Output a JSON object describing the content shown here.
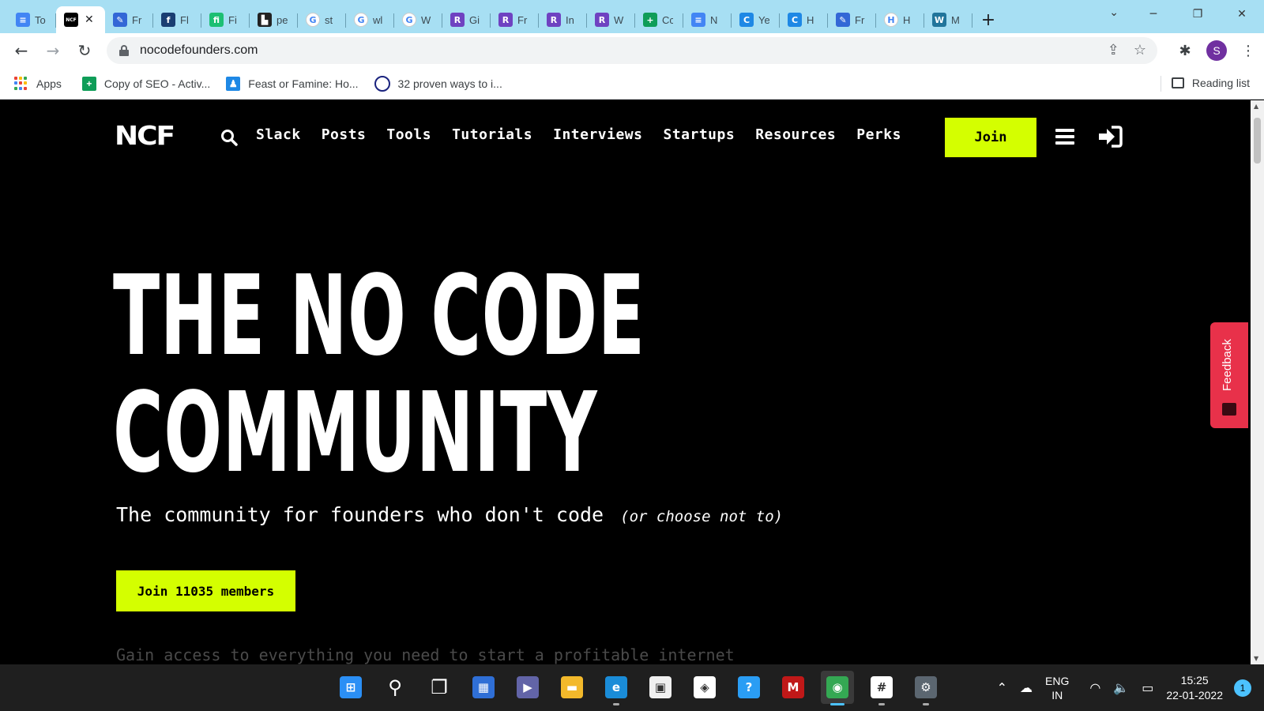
{
  "browser": {
    "tabs": [
      {
        "title": "To",
        "icon": "docs-icon",
        "color": "#4285f4",
        "glyph": "≡"
      },
      {
        "title": "",
        "icon": "ncf-icon",
        "color": "#000000",
        "glyph": "NCF",
        "active": true
      },
      {
        "title": "Fr",
        "icon": "doc-edit-icon",
        "color": "#3367d6",
        "glyph": "✎"
      },
      {
        "title": "Fl",
        "icon": "flip-icon",
        "color": "#1a3e72",
        "glyph": "f"
      },
      {
        "title": "Fi",
        "icon": "fiverr-icon",
        "color": "#1dbf73",
        "glyph": "fi"
      },
      {
        "title": "pe",
        "icon": "people-icon",
        "color": "#222222",
        "glyph": "▙"
      },
      {
        "title": "st",
        "icon": "google-icon",
        "color": "#ffffff",
        "glyph": "G"
      },
      {
        "title": "wl",
        "icon": "google-icon",
        "color": "#ffffff",
        "glyph": "G"
      },
      {
        "title": "W",
        "icon": "google-icon",
        "color": "#ffffff",
        "glyph": "G"
      },
      {
        "title": "Gi",
        "icon": "r-icon",
        "color": "#6f42c1",
        "glyph": "R"
      },
      {
        "title": "Fr",
        "icon": "r-icon",
        "color": "#6f42c1",
        "glyph": "R"
      },
      {
        "title": "In",
        "icon": "r-icon",
        "color": "#6f42c1",
        "glyph": "R"
      },
      {
        "title": "W",
        "icon": "r-icon",
        "color": "#6f42c1",
        "glyph": "R"
      },
      {
        "title": "Cc",
        "icon": "sheets-icon",
        "color": "#0f9d58",
        "glyph": "+"
      },
      {
        "title": "N",
        "icon": "docs-icon",
        "color": "#4285f4",
        "glyph": "≡"
      },
      {
        "title": "Ye",
        "icon": "c-icon",
        "color": "#1e88e5",
        "glyph": "C"
      },
      {
        "title": "H",
        "icon": "c-icon",
        "color": "#1e88e5",
        "glyph": "C"
      },
      {
        "title": "Fr",
        "icon": "doc-edit-icon",
        "color": "#3367d6",
        "glyph": "✎"
      },
      {
        "title": "H",
        "icon": "h-icon",
        "color": "#ffffff",
        "glyph": "H"
      },
      {
        "title": "M",
        "icon": "wordpress-icon",
        "color": "#21759b",
        "glyph": "W"
      }
    ],
    "new_tab_label": "+",
    "url": "nocodefounders.com",
    "bookmarks": [
      {
        "label": "Apps",
        "icon": "apps-icon"
      },
      {
        "label": "Copy of SEO - Activ...",
        "icon": "sheets-icon",
        "color": "#0f9d58"
      },
      {
        "label": "Feast or Famine: Ho...",
        "icon": "bookmark-person-icon",
        "color": "#1e88e5"
      },
      {
        "label": "32 proven ways to i...",
        "icon": "circle-icon",
        "color": "#1a237e"
      }
    ],
    "reading_list_label": "Reading list",
    "profile_initial": "S"
  },
  "site": {
    "logo": "NCF",
    "nav": [
      "Slack",
      "Posts",
      "Tools",
      "Tutorials",
      "Interviews",
      "Startups",
      "Resources",
      "Perks"
    ],
    "join_label": "Join",
    "headline_line1": "THE NO CODE",
    "headline_line2": "COMMUNITY",
    "subtitle": "The community for founders who don't code",
    "subtitle_aside": "(or choose not to)",
    "cta_label": "Join 11035 members",
    "faded_text": "Gain access to everything you need to start a profitable internet",
    "feedback_label": "Feedback",
    "accent_color": "#d4ff00"
  },
  "taskbar": {
    "apps": [
      {
        "name": "windows-start-icon",
        "running": false
      },
      {
        "name": "search-icon",
        "running": false
      },
      {
        "name": "task-view-icon",
        "running": false
      },
      {
        "name": "widgets-icon",
        "running": false
      },
      {
        "name": "teams-chat-icon",
        "running": false
      },
      {
        "name": "file-explorer-icon",
        "running": false
      },
      {
        "name": "edge-icon",
        "running": true
      },
      {
        "name": "microsoft-store-icon",
        "running": false
      },
      {
        "name": "app-icon",
        "running": false
      },
      {
        "name": "help-icon",
        "running": false
      },
      {
        "name": "mcafee-icon",
        "running": false
      },
      {
        "name": "chrome-icon",
        "running": true,
        "active": true
      },
      {
        "name": "slack-icon",
        "running": true
      },
      {
        "name": "settings-icon",
        "running": true
      }
    ],
    "lang_line1": "ENG",
    "lang_line2": "IN",
    "time": "15:25",
    "date": "22-01-2022",
    "notification_count": "1"
  }
}
